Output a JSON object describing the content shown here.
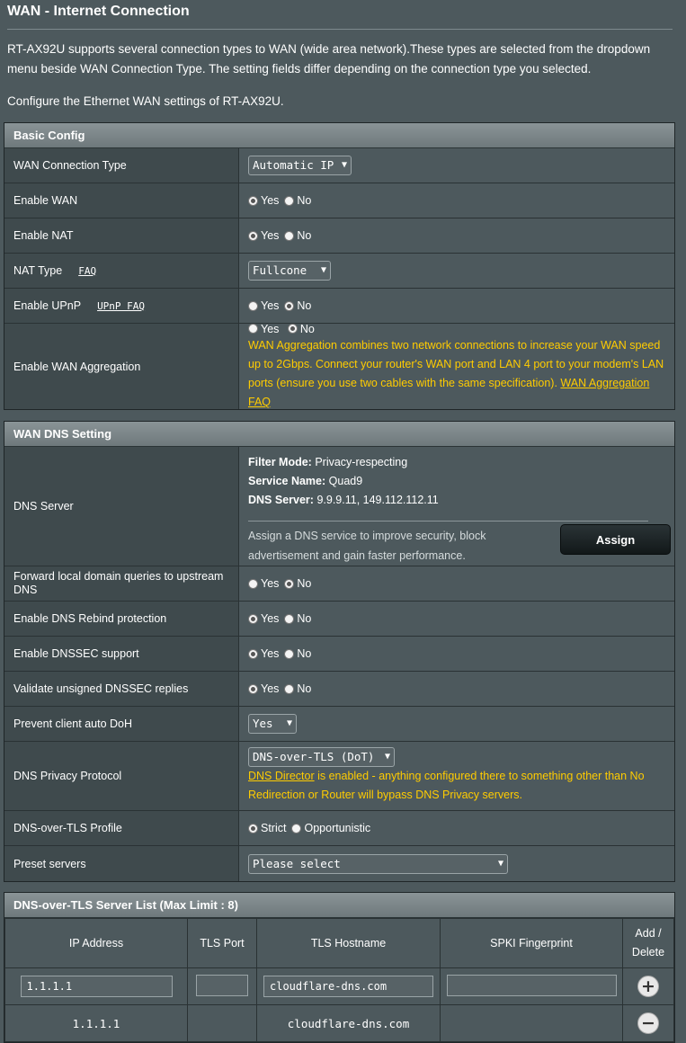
{
  "page": {
    "title": "WAN - Internet Connection",
    "description1": "RT-AX92U supports several connection types to WAN (wide area network).These types are selected from the dropdown menu beside WAN Connection Type. The setting fields differ depending on the connection type you selected.",
    "description2": "Configure the Ethernet WAN settings of RT-AX92U."
  },
  "basic": {
    "header": "Basic Config",
    "wan_conn_label": "WAN Connection Type",
    "wan_conn_value": "Automatic IP",
    "enable_wan_label": "Enable WAN",
    "enable_nat_label": "Enable NAT",
    "nat_type_label": "NAT Type",
    "nat_faq": "FAQ",
    "nat_type_value": "Fullcone",
    "upnp_label": "Enable UPnP",
    "upnp_faq": "UPnP FAQ",
    "agg_label": "Enable WAN Aggregation",
    "agg_note": "WAN Aggregation combines two network connections to increase your WAN speed up to 2Gbps. Connect your router's WAN port and LAN 4 port to your modem's LAN ports (ensure you use two cables with the same specification).",
    "agg_faq": "WAN Aggregation FAQ"
  },
  "radio": {
    "yes": "Yes",
    "no": "No"
  },
  "dns": {
    "header": "WAN DNS Setting",
    "server_label": "DNS Server",
    "filter_mode_key": "Filter Mode:",
    "filter_mode_val": "Privacy-respecting",
    "service_key": "Service Name:",
    "service_val": "Quad9",
    "dns_server_key": "DNS Server:",
    "dns_server_val": "9.9.9.11, 149.112.112.11",
    "assign_note": "Assign a DNS service to improve security, block advertisement and gain faster performance.",
    "assign_button": "Assign",
    "forward_label": "Forward local domain queries to upstream DNS",
    "rebind_label": "Enable DNS Rebind protection",
    "dnssec_label": "Enable DNSSEC support",
    "validate_label": "Validate unsigned DNSSEC replies",
    "doh_label": "Prevent client auto DoH",
    "doh_value": "Yes",
    "privacy_label": "DNS Privacy Protocol",
    "privacy_value": "DNS-over-TLS (DoT)",
    "director_link": "DNS Director",
    "director_note": " is enabled - anything configured there to something other than No Redirection or Router will bypass DNS Privacy servers.",
    "profile_label": "DNS-over-TLS Profile",
    "profile_strict": "Strict",
    "profile_opp": "Opportunistic",
    "preset_label": "Preset servers",
    "preset_value": "Please select"
  },
  "tls_list": {
    "header": "DNS-over-TLS Server List (Max Limit : 8)",
    "col_ip": "IP Address",
    "col_port": "TLS Port",
    "col_host": "TLS Hostname",
    "col_spki": "SPKI Fingerprint",
    "col_add_del": "Add / Delete",
    "input_ip": "1.1.1.1",
    "input_port": "",
    "input_host": "cloudflare-dns.com",
    "input_spki": "",
    "rows": [
      {
        "ip": "1.1.1.1",
        "port": "",
        "host": "cloudflare-dns.com",
        "spki": ""
      }
    ]
  }
}
